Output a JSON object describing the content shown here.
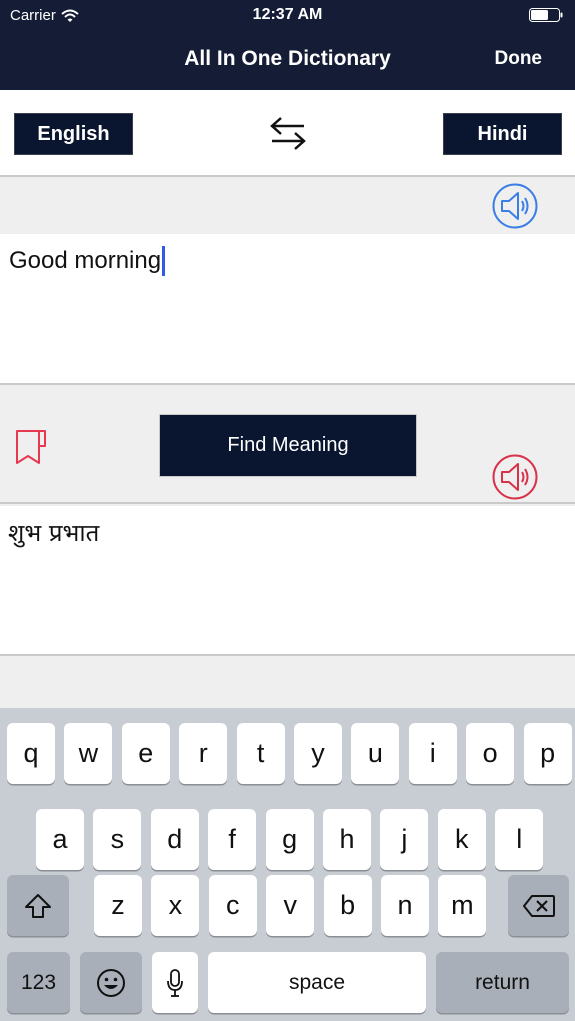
{
  "status_bar": {
    "carrier": "Carrier",
    "time": "12:37 AM",
    "wifi_icon": "wifi-icon",
    "battery_icon": "battery-icon",
    "battery_level": 0.6
  },
  "nav": {
    "title": "All In One Dictionary",
    "done_label": "Done"
  },
  "languages": {
    "source": "English",
    "target": "Hindi",
    "swap_icon": "swap-arrows-icon"
  },
  "source": {
    "speaker_icon": "speaker-icon",
    "speaker_color": "#3a7ee6",
    "text": "Good morning",
    "caret_color": "#2f5be8"
  },
  "actions": {
    "bookmark_icon": "bookmark-icon",
    "bookmark_color": "#e8384f",
    "find_meaning_label": "Find Meaning",
    "speaker_icon": "speaker-icon",
    "speaker_color": "#d8314a"
  },
  "result": {
    "text": "शुभ प्रभात"
  },
  "keyboard": {
    "row1": [
      "q",
      "w",
      "e",
      "r",
      "t",
      "y",
      "u",
      "i",
      "o",
      "p"
    ],
    "row2": [
      "a",
      "s",
      "d",
      "f",
      "g",
      "h",
      "j",
      "k",
      "l"
    ],
    "row3": [
      "z",
      "x",
      "c",
      "v",
      "b",
      "n",
      "m"
    ],
    "shift_icon": "shift-icon",
    "backspace_icon": "backspace-icon",
    "numbers_label": "123",
    "emoji_icon": "emoji-icon",
    "mic_icon": "microphone-icon",
    "space_label": "space",
    "return_label": "return"
  },
  "colors": {
    "header_bg": "#141d35",
    "button_bg": "#0a1530"
  }
}
